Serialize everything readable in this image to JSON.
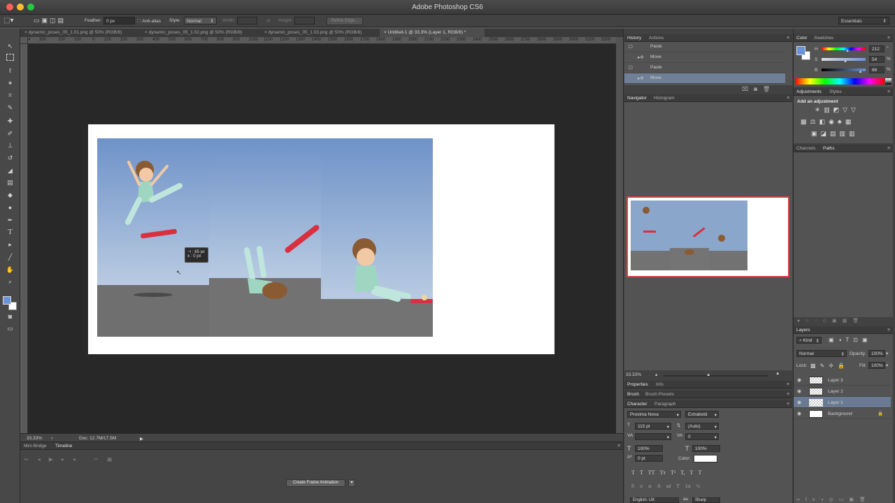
{
  "app": {
    "title": "Adobe Photoshop CS6"
  },
  "options_bar": {
    "feather_label": "Feather:",
    "feather_value": "0 px",
    "antialias_label": "Anti-alias",
    "style_label": "Style:",
    "style_value": "Normal",
    "width_label": "Width:",
    "height_label": "Height:",
    "refine_edge": "Refine Edge...",
    "workspace": "Essentials"
  },
  "doc_tabs": [
    {
      "label": "dynamic_poses_05_1.01.png @ 50% (RGB/8)",
      "close": "×"
    },
    {
      "label": "dynamic_poses_05_1.02.png @ 50% (RGB/8)",
      "close": "×"
    },
    {
      "label": "dynamic_poses_05_1.03.png @ 50% (RGB/8)",
      "close": "×"
    },
    {
      "label": "Untitled-1 @ 33.3% (Layer 1, RGB/8) *",
      "close": "×"
    }
  ],
  "ruler_ticks": [
    "4",
    "300",
    "200",
    "100",
    "0",
    "100",
    "200",
    "300",
    "400",
    "500",
    "600",
    "700",
    "800",
    "900",
    "1000",
    "1100",
    "1200",
    "1300",
    "1400",
    "1500",
    "1600",
    "1700",
    "1800",
    "1900",
    "2000",
    "2100",
    "2200",
    "2300",
    "2400",
    "2500",
    "2600",
    "2700",
    "2800",
    "2900",
    "3000",
    "3100",
    "3200",
    "3300"
  ],
  "move_tooltip": {
    "dx": "⊣ : 65 px",
    "dy": "± :   0 px"
  },
  "status": {
    "zoom": "33.33%",
    "doc": "Doc: 12.7M/17.5M"
  },
  "bottom_panel": {
    "tabs": [
      "Mini Bridge",
      "Timeline"
    ],
    "button": "Create Frame Animation"
  },
  "history": {
    "tabs": [
      "History",
      "Actions"
    ],
    "items": [
      {
        "label": "Paste",
        "icon": "paste-icon"
      },
      {
        "label": "Move",
        "icon": "move-icon"
      },
      {
        "label": "Paste",
        "icon": "paste-icon"
      },
      {
        "label": "Move",
        "icon": "move-icon"
      }
    ],
    "selected_index": 3
  },
  "navigator": {
    "tabs": [
      "Navigator",
      "Histogram"
    ],
    "zoom": "33.33%"
  },
  "properties": {
    "tabs": [
      "Properties",
      "Info"
    ]
  },
  "brush": {
    "tabs": [
      "Brush",
      "Brush Presets"
    ]
  },
  "character": {
    "tabs": [
      "Character",
      "Paragraph"
    ],
    "font": "Proxima Nova",
    "weight": "Extrabold",
    "size": "115 pt",
    "leading": "(Auto)",
    "kerning": "",
    "tracking": "0",
    "vscale": "100%",
    "hscale": "100%",
    "baseline": "0 pt",
    "color_label": "Color:",
    "color": "#ffffff",
    "type_buttons": [
      "T",
      "T",
      "TT",
      "Tт",
      "T¹",
      "T,",
      "T",
      "T"
    ],
    "opentype_buttons": [
      "fi",
      "σ",
      "st",
      "A",
      "ad",
      "T",
      "1st",
      "½"
    ],
    "language": "English: UK",
    "aa_label": "aa",
    "antialias": "Sharp"
  },
  "color_panel": {
    "tabs": [
      "Color",
      "Swatches"
    ],
    "h_label": "H",
    "h": "212",
    "h_unit": "°",
    "s_label": "S",
    "s": "54",
    "s_unit": "%",
    "b_label": "B",
    "b": "88",
    "b_unit": "%",
    "fg": "#6b94d6",
    "bg": "#ffffff",
    "h_frac": 0.59,
    "s_frac": 0.54,
    "b_frac": 0.88
  },
  "adjustments": {
    "tabs": [
      "Adjustments",
      "Styles"
    ],
    "heading": "Add an adjustment"
  },
  "channels": {
    "tabs": [
      "Channels",
      "Paths"
    ]
  },
  "layers": {
    "tab": "Layers",
    "kind": "Kind",
    "blend": "Normal",
    "opacity_label": "Opacity:",
    "opacity": "100%",
    "lock_label": "Lock:",
    "fill_label": "Fill:",
    "fill": "100%",
    "items": [
      {
        "name": "Layer 3"
      },
      {
        "name": "Layer 2"
      },
      {
        "name": "Layer 1"
      },
      {
        "name": "Background"
      }
    ],
    "selected_index": 2
  }
}
